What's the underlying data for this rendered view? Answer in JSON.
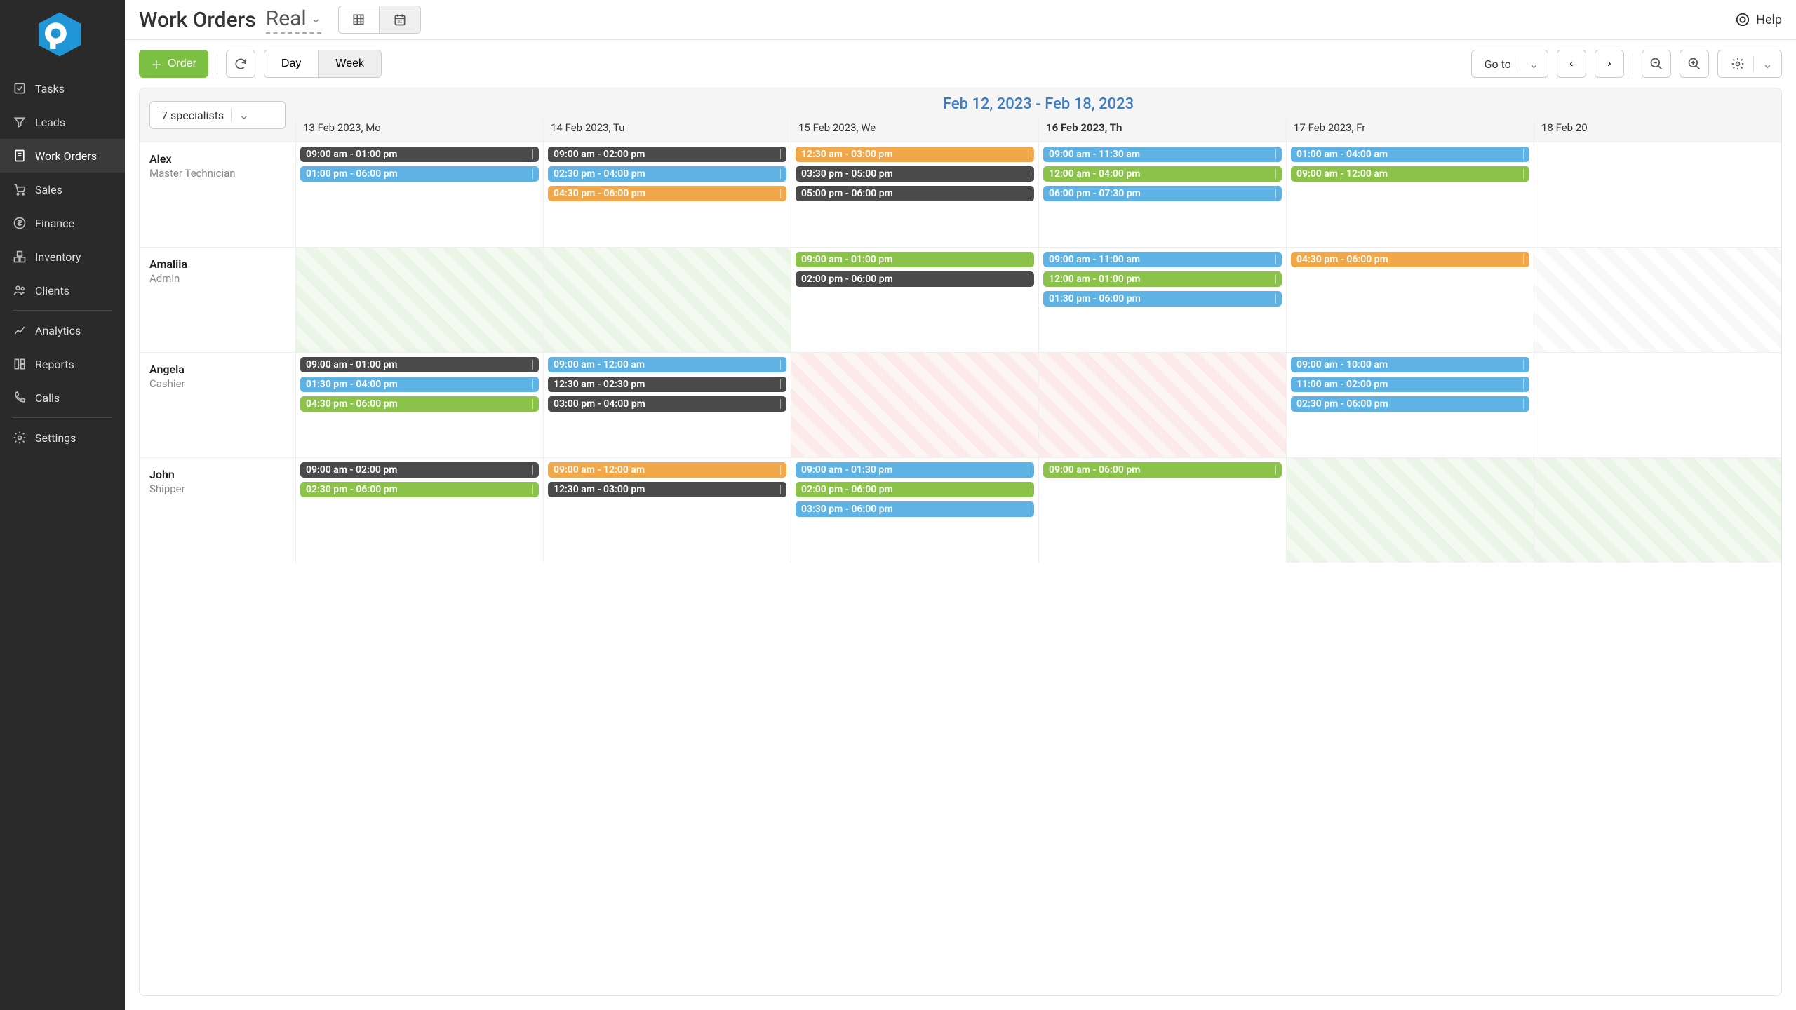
{
  "header": {
    "title": "Work Orders",
    "subtitle": "Real",
    "help": "Help"
  },
  "sidebar": {
    "items": [
      {
        "label": "Tasks"
      },
      {
        "label": "Leads"
      },
      {
        "label": "Work Orders"
      },
      {
        "label": "Sales"
      },
      {
        "label": "Finance"
      },
      {
        "label": "Inventory"
      },
      {
        "label": "Clients"
      },
      {
        "label": "Analytics"
      },
      {
        "label": "Reports"
      },
      {
        "label": "Calls"
      },
      {
        "label": "Settings"
      }
    ]
  },
  "toolbar": {
    "order": "Order",
    "day": "Day",
    "week": "Week",
    "goto": "Go to"
  },
  "calendar": {
    "specialists_filter": "7 specialists",
    "range": "Feb 12, 2023 - Feb 18, 2023",
    "days": [
      {
        "label": "13 Feb 2023, Mo",
        "bold": false
      },
      {
        "label": "14 Feb 2023, Tu",
        "bold": false
      },
      {
        "label": "15 Feb 2023, We",
        "bold": false
      },
      {
        "label": "16 Feb 2023, Th",
        "bold": true
      },
      {
        "label": "17 Feb 2023, Fr",
        "bold": false
      },
      {
        "label": "18 Feb 20",
        "bold": false
      }
    ],
    "rows": [
      {
        "name": "Alex",
        "role": "Master Technician",
        "cells": [
          {
            "stripe": null,
            "events": [
              {
                "t": "09:00 am - 01:00 pm",
                "c": "dark"
              },
              {
                "t": "01:00 pm - 06:00 pm",
                "c": "blue"
              }
            ]
          },
          {
            "stripe": null,
            "events": [
              {
                "t": "09:00 am - 02:00 pm",
                "c": "dark"
              },
              {
                "t": "02:30 pm - 04:00 pm",
                "c": "blue"
              },
              {
                "t": "04:30 pm - 06:00 pm",
                "c": "orange"
              }
            ]
          },
          {
            "stripe": null,
            "events": [
              {
                "t": "12:30 am - 03:00 pm",
                "c": "orange"
              },
              {
                "t": "03:30 pm - 05:00 pm",
                "c": "dark"
              },
              {
                "t": "05:00 pm - 06:00 pm",
                "c": "dark"
              }
            ]
          },
          {
            "stripe": null,
            "events": [
              {
                "t": "09:00 am - 11:30 am",
                "c": "blue"
              },
              {
                "t": "12:00 am - 04:00 pm",
                "c": "green"
              },
              {
                "t": "06:00 pm - 07:30 pm",
                "c": "blue"
              }
            ]
          },
          {
            "stripe": null,
            "events": [
              {
                "t": "01:00 am - 04:00 am",
                "c": "blue"
              },
              {
                "t": "09:00 am - 12:00 am",
                "c": "green"
              }
            ]
          },
          {
            "stripe": null,
            "events": []
          }
        ]
      },
      {
        "name": "Amaliia",
        "role": "Admin",
        "cells": [
          {
            "stripe": "green",
            "events": []
          },
          {
            "stripe": "green",
            "events": []
          },
          {
            "stripe": null,
            "events": [
              {
                "t": "09:00 am - 01:00 pm",
                "c": "green"
              },
              {
                "t": "02:00 pm - 06:00 pm",
                "c": "dark"
              }
            ]
          },
          {
            "stripe": null,
            "events": [
              {
                "t": "09:00 am - 11:00 am",
                "c": "blue"
              },
              {
                "t": "12:00 am - 01:00 pm",
                "c": "green"
              },
              {
                "t": "01:30 pm - 06:00 pm",
                "c": "blue"
              }
            ]
          },
          {
            "stripe": null,
            "events": [
              {
                "t": "04:30 pm - 06:00 pm",
                "c": "orange"
              }
            ]
          },
          {
            "stripe": "white",
            "events": []
          }
        ]
      },
      {
        "name": "Angela",
        "role": "Cashier",
        "cells": [
          {
            "stripe": null,
            "events": [
              {
                "t": "09:00 am - 01:00 pm",
                "c": "dark"
              },
              {
                "t": "01:30 pm - 04:00 pm",
                "c": "blue"
              },
              {
                "t": "04:30 pm - 06:00 pm",
                "c": "green"
              }
            ]
          },
          {
            "stripe": null,
            "events": [
              {
                "t": "09:00 am - 12:00 am",
                "c": "blue"
              },
              {
                "t": "12:30 am - 02:30 pm",
                "c": "dark"
              },
              {
                "t": "03:00 pm - 04:00 pm",
                "c": "dark"
              }
            ]
          },
          {
            "stripe": "pink",
            "events": []
          },
          {
            "stripe": "pink",
            "events": []
          },
          {
            "stripe": null,
            "events": [
              {
                "t": "09:00 am - 10:00 am",
                "c": "blue"
              },
              {
                "t": "11:00 am - 02:00 pm",
                "c": "blue"
              },
              {
                "t": "02:30 pm - 06:00 pm",
                "c": "blue"
              }
            ]
          },
          {
            "stripe": null,
            "events": []
          }
        ]
      },
      {
        "name": "John",
        "role": "Shipper",
        "cells": [
          {
            "stripe": null,
            "events": [
              {
                "t": "09:00 am - 02:00 pm",
                "c": "dark"
              },
              {
                "t": "02:30 pm - 06:00 pm",
                "c": "green"
              }
            ]
          },
          {
            "stripe": null,
            "events": [
              {
                "t": "09:00 am - 12:00 am",
                "c": "orange"
              },
              {
                "t": "12:30 am - 03:00 pm",
                "c": "dark"
              }
            ]
          },
          {
            "stripe": null,
            "events": [
              {
                "t": "09:00 am - 01:30 pm",
                "c": "blue"
              },
              {
                "t": "02:00 pm - 06:00 pm",
                "c": "green"
              },
              {
                "t": "03:30 pm - 06:00 pm",
                "c": "blue"
              }
            ]
          },
          {
            "stripe": null,
            "events": [
              {
                "t": "09:00 am - 06:00 pm",
                "c": "green"
              }
            ]
          },
          {
            "stripe": "green",
            "events": []
          },
          {
            "stripe": "green",
            "events": []
          }
        ]
      }
    ]
  }
}
